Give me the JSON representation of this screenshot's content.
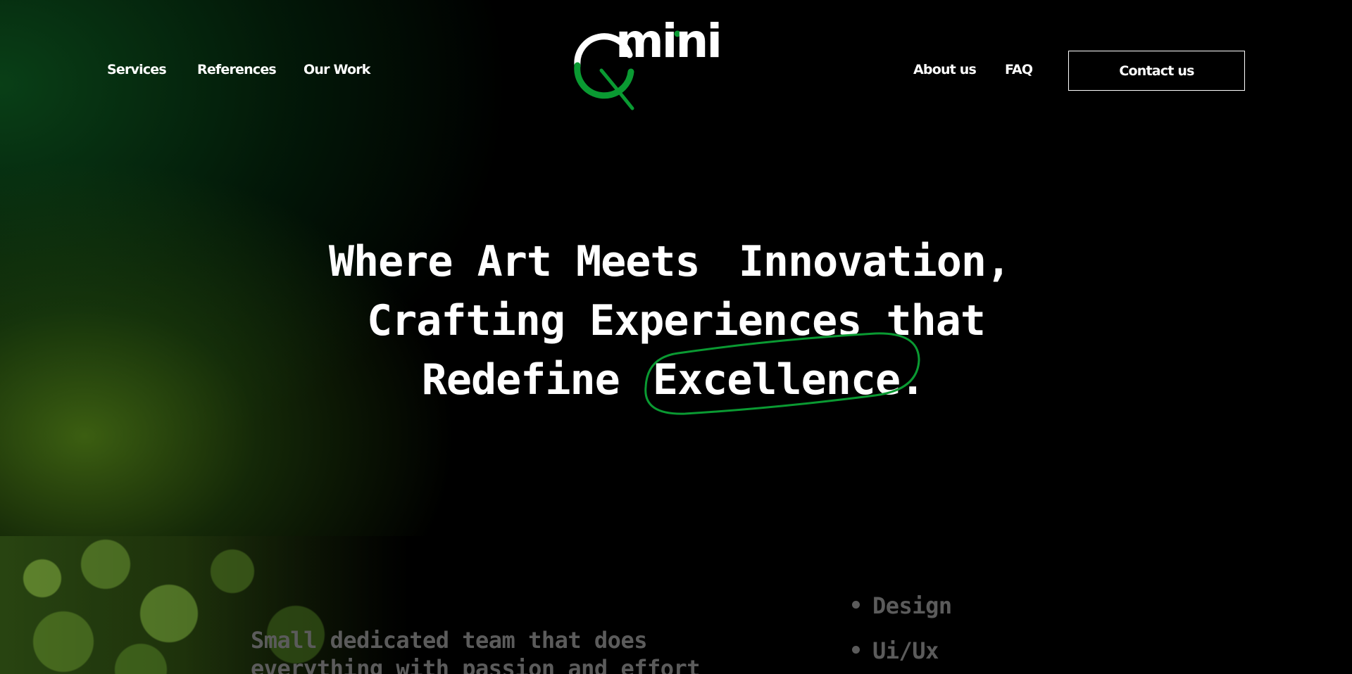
{
  "nav": {
    "left_items": [
      "Services",
      "References",
      "Our Work"
    ],
    "right_items": [
      "About us",
      "FAQ"
    ],
    "contact_label": "Contact us"
  },
  "logo": {
    "word": "mini",
    "icon": "q-mark-logo"
  },
  "hero": {
    "line1_before": "Where Art Meets",
    "line1_highlight": "Innovation,",
    "line2": "Crafting Experiences that",
    "line3_before": "Redefine",
    "line3_highlight": "Excellence."
  },
  "about": {
    "team_line1": "Small dedicated team that does",
    "team_line2": "everything with passion and effort"
  },
  "services": [
    "Design",
    "Ui/Ux"
  ],
  "colors": {
    "accent": "#0a9a32",
    "background": "#000000",
    "muted_text": "#5b5b5b"
  }
}
